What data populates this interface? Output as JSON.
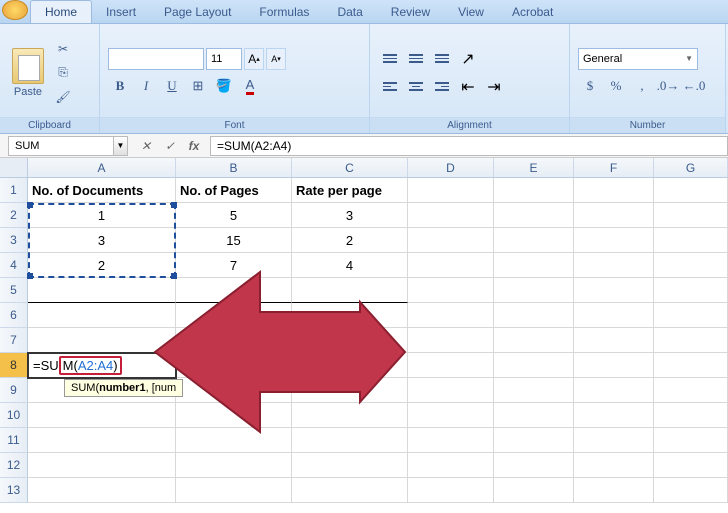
{
  "tabs": [
    "Home",
    "Insert",
    "Page Layout",
    "Formulas",
    "Data",
    "Review",
    "View",
    "Acrobat"
  ],
  "active_tab": 0,
  "ribbon": {
    "clipboard": {
      "label": "Clipboard",
      "paste": "Paste"
    },
    "font": {
      "label": "Font",
      "name": "",
      "size": "11",
      "grow": "A",
      "shrink": "A",
      "bold": "B",
      "italic": "I",
      "underline": "U"
    },
    "alignment": {
      "label": "Alignment"
    },
    "number": {
      "label": "Number",
      "format": "General",
      "currency": "$",
      "percent": "%",
      "comma": ","
    }
  },
  "name_box": "SUM",
  "formula_bar": "=SUM(A2:A4)",
  "columns": [
    "A",
    "B",
    "C",
    "D",
    "E",
    "F",
    "G"
  ],
  "rows_visible": 13,
  "table": {
    "headers": [
      "No. of Documents",
      "No. of Pages",
      "Rate per page"
    ],
    "data": [
      [
        "1",
        "5",
        "3"
      ],
      [
        "3",
        "15",
        "2"
      ],
      [
        "2",
        "7",
        "4"
      ]
    ]
  },
  "active_cell": {
    "address": "A8",
    "prefix": "=SU",
    "mid": "M(",
    "range": "A2:A4",
    "suffix": ")"
  },
  "tooltip": {
    "fn": "SUM(",
    "arg1": "number1",
    "rest": ", [num"
  },
  "selection_range": "A2:A4"
}
